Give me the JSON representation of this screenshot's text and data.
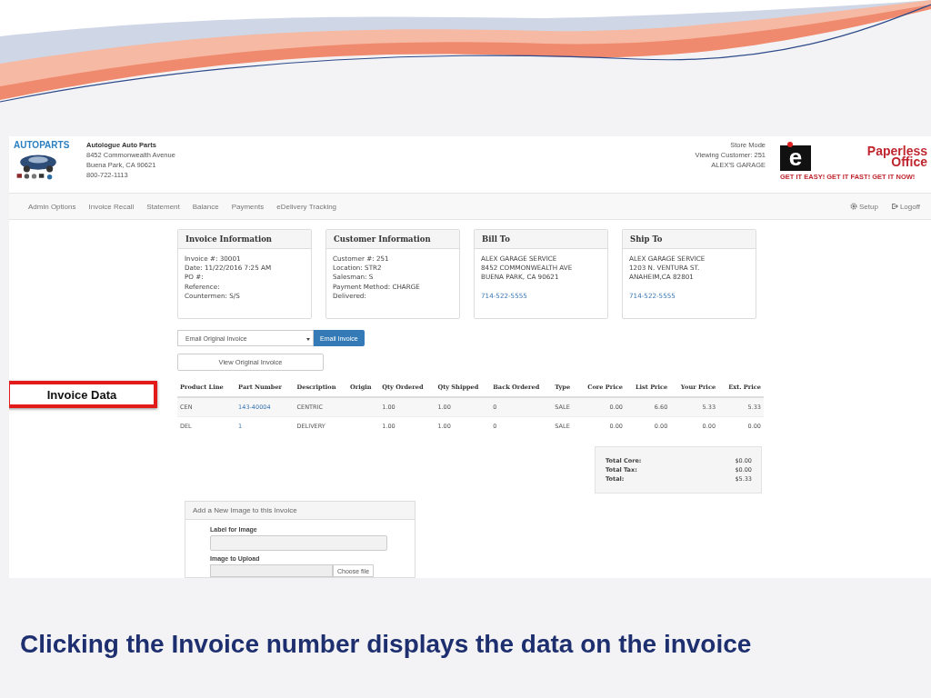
{
  "slide": {
    "caption": "Clicking the Invoice number displays the data on the invoice"
  },
  "header": {
    "brand": "AUTOPARTS",
    "store_name": "Autologue Auto Parts",
    "store_lines": [
      "8452 Commonwealth Avenue",
      "Buena Park, CA 90621",
      "800-722-1113"
    ],
    "status_lines": [
      "Store Mode",
      "Viewing Customer: 251",
      "ALEX'S GARAGE"
    ],
    "logo": {
      "letter": "e",
      "word1": "Paperless",
      "word2": "Office",
      "slogan": "GET IT EASY! GET IT FAST! GET IT NOW!"
    }
  },
  "nav": {
    "items": [
      "Admin Options",
      "Invoice Recall",
      "Statement",
      "Balance",
      "Payments",
      "eDelivery Tracking"
    ],
    "right_items": [
      {
        "label": "Setup",
        "kind": "setup"
      },
      {
        "label": "Logoff",
        "kind": "logoff"
      }
    ]
  },
  "panels": [
    {
      "title": "Invoice Information",
      "lines": [
        {
          "text": "Invoice #: 30001",
          "kind": "text"
        },
        {
          "text": "Date: 11/22/2016 7:25 AM",
          "kind": "text"
        },
        {
          "text": "PO #:",
          "kind": "text"
        },
        {
          "text": "Reference:",
          "kind": "text"
        },
        {
          "text": "Countermen: S/S",
          "kind": "text"
        }
      ]
    },
    {
      "title": "Customer Information",
      "lines": [
        {
          "text": "Customer #: 251",
          "kind": "text"
        },
        {
          "text": "Location: STR2",
          "kind": "text"
        },
        {
          "text": "Salesman: S",
          "kind": "text"
        },
        {
          "text": "Payment Method: CHARGE",
          "kind": "text"
        },
        {
          "text": "Delivered:",
          "kind": "text"
        }
      ]
    },
    {
      "title": "Bill To",
      "lines": [
        {
          "text": "ALEX GARAGE SERVICE",
          "kind": "text"
        },
        {
          "text": "8452 COMMONWEALTH AVE",
          "kind": "text"
        },
        {
          "text": "BUENA PARK, CA 90621",
          "kind": "text"
        },
        {
          "text": "714-522-5555",
          "kind": "link"
        }
      ]
    },
    {
      "title": "Ship To",
      "lines": [
        {
          "text": "ALEX GARAGE SERVICE",
          "kind": "text"
        },
        {
          "text": "1203 N. VENTURA ST.",
          "kind": "text"
        },
        {
          "text": "ANAHEIM,CA 82801",
          "kind": "text"
        },
        {
          "text": "714-522-5555",
          "kind": "link"
        }
      ]
    }
  ],
  "email": {
    "select_value": "Email Original Invoice",
    "button": "Email Invoice"
  },
  "view_button": "View Original Invoice",
  "callout": {
    "label": "Invoice Data"
  },
  "table": {
    "columns": [
      "Product Line",
      "Part Number",
      "Description",
      "Origin",
      "Qty Ordered",
      "Qty Shipped",
      "Back Ordered",
      "Type",
      "Core Price",
      "List Price",
      "Your Price",
      "Ext. Price"
    ],
    "rows": [
      {
        "cells": [
          "CEN",
          "143-40004",
          "CENTRIC",
          "",
          "1.00",
          "1.00",
          "0",
          "SALE",
          "0.00",
          "6.60",
          "5.33",
          "5.33"
        ]
      },
      {
        "cells": [
          "DEL",
          "1",
          "DELIVERY",
          "",
          "1.00",
          "1.00",
          "0",
          "SALE",
          "0.00",
          "0.00",
          "0.00",
          "0.00"
        ]
      }
    ]
  },
  "totals": [
    {
      "label": "Total Core:",
      "value": "$0.00"
    },
    {
      "label": "Total Tax:",
      "value": "$0.00"
    },
    {
      "label": "Total:",
      "value": "$5.33"
    }
  ],
  "upload": {
    "title": "Add a New Image to this Invoice",
    "fields": [
      {
        "label": "Label for Image",
        "kind": "text"
      },
      {
        "label": "Image to Upload",
        "kind": "file",
        "button": "Choose file"
      }
    ]
  }
}
